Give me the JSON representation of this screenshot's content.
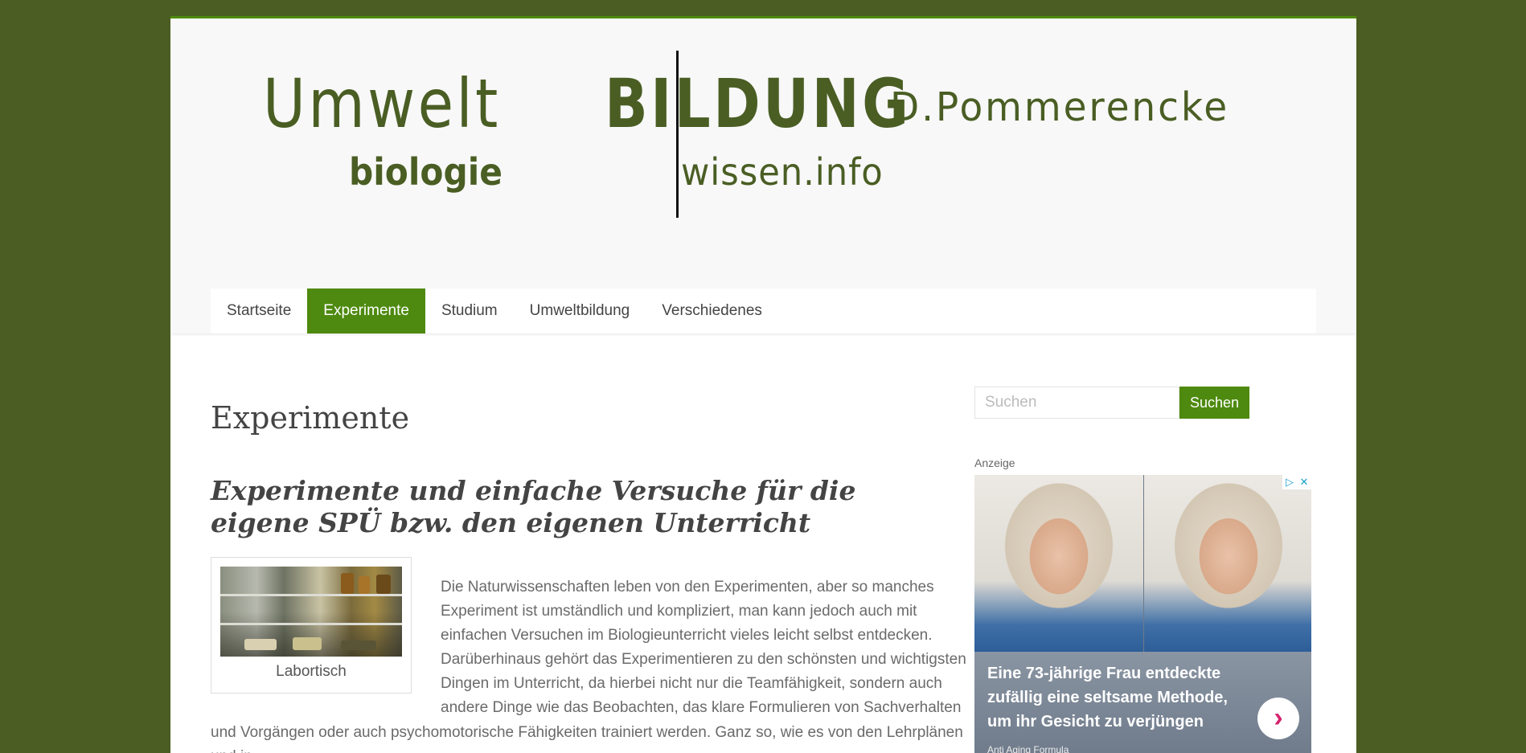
{
  "colors": {
    "background": "#4b5d22",
    "accent": "#4e8a0f",
    "logo": "#4a5e24"
  },
  "logo": {
    "umwelt": "Umwelt",
    "bildung": "BILDUNG",
    "biologie": "biologie",
    "wissen": "wissen.info",
    "name": "D.Pommerencke"
  },
  "nav": {
    "items": [
      {
        "label": "Startseite"
      },
      {
        "label": "Experimente"
      },
      {
        "label": "Studium"
      },
      {
        "label": "Umweltbildung"
      },
      {
        "label": "Verschiedenes"
      }
    ],
    "active": "Experimente"
  },
  "main": {
    "title": "Experimente",
    "heading": "Experimente und einfache Versuche für die eigene SPÜ bzw. den eigenen Unterricht",
    "figure_caption": "Labortisch",
    "body": "Die Naturwissenschaften leben von den Experimenten, aber so manches Experiment ist umständlich und kompliziert, man kann jedoch auch mit einfachen Versuchen im Biologieunterricht vieles leicht selbst entdecken. Darüberhinaus gehört das Experimentieren zu den schönsten und wichtigsten Dingen im Unterricht, da hierbei nicht nur die Teamfähigkeit, sondern auch andere Dinge wie das Beobachten, das klare Formulieren von Sachverhalten und Vorgängen oder auch psychomotorische Fähigkeiten trainiert werden. Ganz so, wie es von den Lehrplänen und in"
  },
  "sidebar": {
    "search_placeholder": "Suchen",
    "search_button": "Suchen",
    "ad_label": "Anzeige",
    "ad": {
      "headline": "Eine 73-jährige Frau entdeckte zufällig eine seltsame Methode, um ihr Gesicht zu verjüngen",
      "source": "Anti Aging Formula",
      "arrow": "›",
      "adchoices": "▷",
      "close": "✕"
    }
  }
}
